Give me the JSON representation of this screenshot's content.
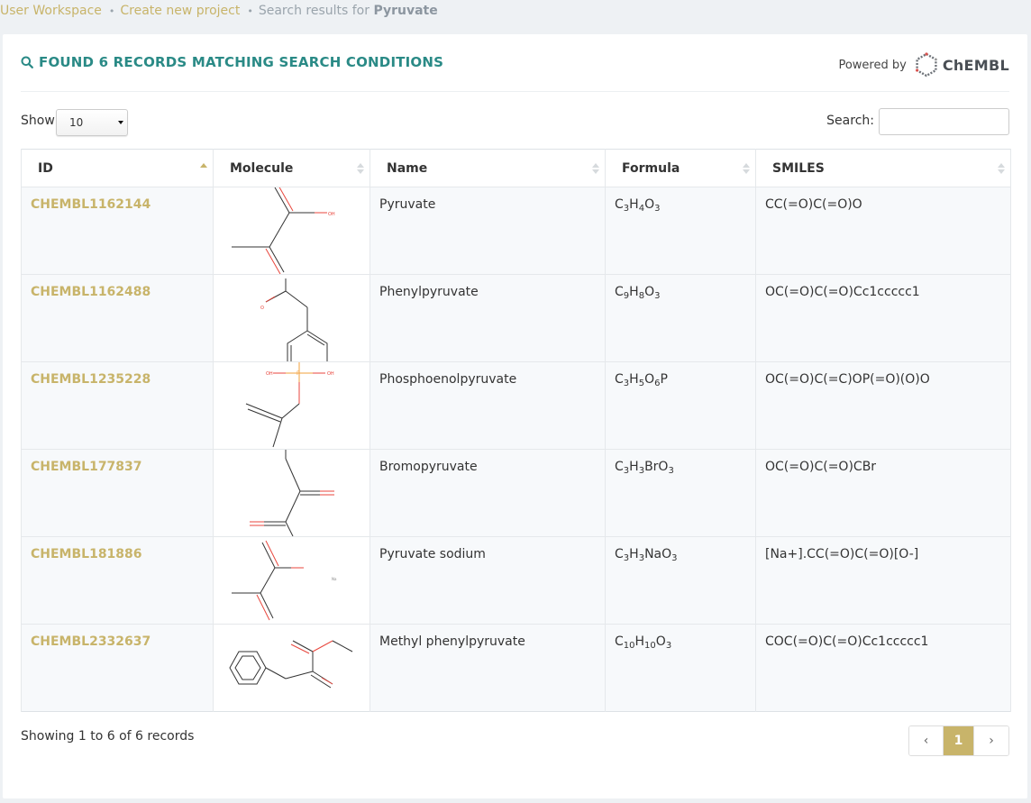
{
  "breadcrumb": {
    "items": [
      "User Workspace",
      "Create new project"
    ],
    "current_prefix": "Search results for",
    "current_term": "Pyruvate"
  },
  "header": {
    "title": "FOUND 6 RECORDS MATCHING SEARCH CONDITIONS",
    "powered_by": "Powered by",
    "logo_text": "ChEMBL"
  },
  "controls": {
    "show_label": "Show",
    "page_size": "10",
    "search_label": "Search:",
    "search_value": ""
  },
  "table": {
    "columns": [
      "ID",
      "Molecule",
      "Name",
      "Formula",
      "SMILES"
    ],
    "rows": [
      {
        "id": "CHEMBL1162144",
        "name": "Pyruvate",
        "formula": "C3H4O3",
        "smiles": "CC(=O)C(=O)O"
      },
      {
        "id": "CHEMBL1162488",
        "name": "Phenylpyruvate",
        "formula": "C9H8O3",
        "smiles": "OC(=O)C(=O)Cc1ccccc1"
      },
      {
        "id": "CHEMBL1235228",
        "name": "Phosphoenolpyruvate",
        "formula": "C3H5O6P",
        "smiles": "OC(=O)C(=C)OP(=O)(O)O"
      },
      {
        "id": "CHEMBL177837",
        "name": "Bromopyruvate",
        "formula": "C3H3BrO3",
        "smiles": "OC(=O)C(=O)CBr"
      },
      {
        "id": "CHEMBL181886",
        "name": "Pyruvate sodium",
        "formula": "C3H3NaO3",
        "smiles": "[Na+].CC(=O)C(=O)[O-]"
      },
      {
        "id": "CHEMBL2332637",
        "name": "Methyl phenylpyruvate",
        "formula": "C10H10O3",
        "smiles": "COC(=O)C(=O)Cc1ccccc1"
      }
    ]
  },
  "footer": {
    "info": "Showing 1 to 6 of 6 records",
    "prev": "‹",
    "current_page": "1",
    "next": "›"
  },
  "colors": {
    "accent": "#c8b46a",
    "title": "#2a8a86",
    "bond": "#333333",
    "oxygen": "#e8463c",
    "phosphorus": "#f2a13b"
  },
  "icons": [
    "search-icon",
    "chembl-logo-icon",
    "sort-asc-icon",
    "sort-both-icon",
    "chevron-left-icon",
    "chevron-right-icon"
  ]
}
